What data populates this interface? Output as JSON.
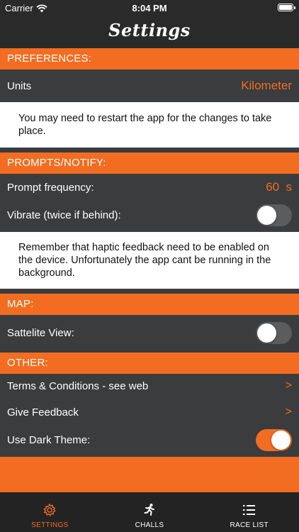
{
  "status_bar": {
    "carrier": "Carrier",
    "time": "8:04 PM"
  },
  "nav": {
    "title": "Settings"
  },
  "sections": {
    "preferences": "PREFERENCES:",
    "prompts": "PROMPTS/NOTIFY:",
    "map": "MAP:",
    "other": "OTHER:"
  },
  "preferences": {
    "units_label": "Units",
    "units_value": "Kilometer",
    "note": "You may need to restart the app for the changes to take place."
  },
  "prompts": {
    "frequency_label": "Prompt frequency:",
    "frequency_value": "60  s",
    "vibrate_label": "Vibrate (twice if behind):",
    "vibrate_on": false,
    "note": "Remember that haptic feedback need to be enabled on the device. Unfortunately the app cant be running in the background."
  },
  "map": {
    "satellite_label": "Sattelite View:",
    "satellite_on": false
  },
  "other": {
    "terms_label": "Terms & Conditions - see web",
    "feedback_label": "Give Feedback",
    "chevron": ">",
    "dark_theme_label": "Use Dark Theme:",
    "dark_theme_on": true
  },
  "tabs": [
    {
      "label": "SETTINGS",
      "icon": "gear-icon",
      "active": true
    },
    {
      "label": "CHALLS",
      "icon": "runner-icon",
      "active": false
    },
    {
      "label": "RACE LIST",
      "icon": "list-icon",
      "active": false
    }
  ],
  "colors": {
    "accent": "#f26d21",
    "background": "#3a3c3e",
    "bar": "#2a2a2a"
  }
}
